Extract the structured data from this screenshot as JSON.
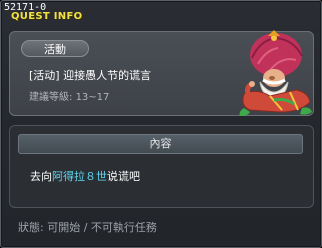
{
  "window": {
    "quest_id": "52171-0",
    "title": "QUEST INFO"
  },
  "info": {
    "category": "活動",
    "quest_title": "[活动] 迎接愚人节的谎言",
    "level_label": "建議等級:",
    "level_range": "13~17"
  },
  "content": {
    "header": "內容",
    "text_before": "去向",
    "npc_name": "阿得拉８世",
    "text_after": "说谎吧"
  },
  "status": {
    "label": "狀態:",
    "value": "可開始 / 不可執行任務"
  },
  "npc": {
    "icon": "npc-adela-viii-portrait",
    "turban_color": "#c0325a",
    "robe_color": "#d04a3a",
    "beard_color": "#f4f1ea"
  }
}
